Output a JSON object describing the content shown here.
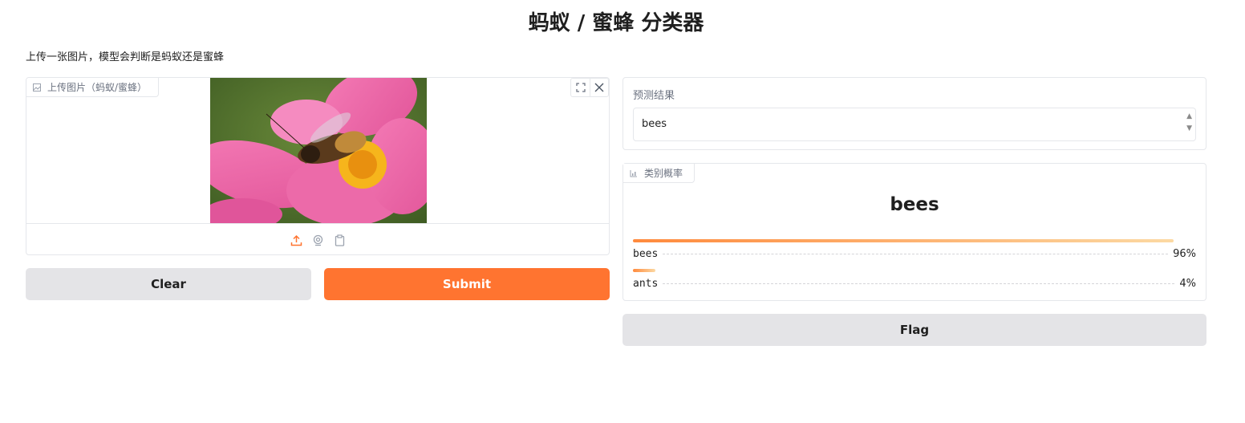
{
  "page": {
    "title": "蚂蚁 / 蜜蜂 分类器",
    "description": "上传一张图片，模型会判断是蚂蚁还是蜜蜂"
  },
  "image_input": {
    "label": "上传图片（蚂蚁/蜜蜂）",
    "sources": [
      "upload-icon",
      "webcam-icon",
      "clipboard-icon"
    ]
  },
  "buttons": {
    "clear": "Clear",
    "submit": "Submit",
    "flag": "Flag"
  },
  "prediction": {
    "label": "预测结果",
    "value": "bees"
  },
  "class_probabilities": {
    "label": "类别概率",
    "top_label": "bees",
    "confidences": [
      {
        "name": "bees",
        "percent": "96%",
        "fraction": 0.96
      },
      {
        "name": "ants",
        "percent": "4%",
        "fraction": 0.04
      }
    ]
  },
  "colors": {
    "accent": "#ff7430",
    "secondary_button": "#e4e4e7"
  }
}
